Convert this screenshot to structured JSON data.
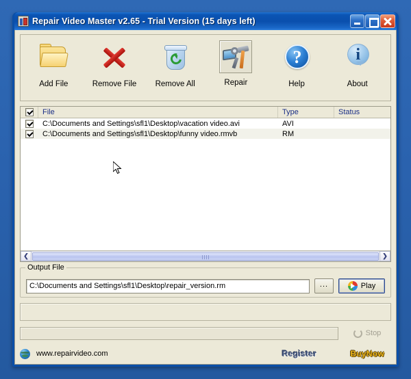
{
  "window": {
    "title": "Repair Video Master v2.65 - Trial Version (15 days left)",
    "app_icon": "app-icon",
    "controls": {
      "minimize": "minimize-button",
      "maximize": "maximize-button",
      "close": "close-button"
    }
  },
  "toolbar": {
    "items": [
      {
        "label": "Add File",
        "icon": "folder-icon"
      },
      {
        "label": "Remove File",
        "icon": "red-x-icon"
      },
      {
        "label": "Remove All",
        "icon": "recycle-bin-icon"
      },
      {
        "label": "Repair",
        "icon": "hammer-wrench-icon"
      },
      {
        "label": "Help",
        "icon": "question-mark-icon"
      },
      {
        "label": "About",
        "icon": "info-icon"
      }
    ]
  },
  "filelist": {
    "columns": [
      "",
      "File",
      "Type",
      "Status"
    ],
    "header_checkbox_checked": true,
    "rows": [
      {
        "checked": true,
        "file": "C:\\Documents and Settings\\sfl1\\Desktop\\vacation video.avi",
        "type": "AVI",
        "status": ""
      },
      {
        "checked": true,
        "file": "C:\\Documents and Settings\\sfl1\\Desktop\\funny video.rmvb",
        "type": "RM",
        "status": ""
      }
    ],
    "scrollbar": {
      "left_arrow": "❮",
      "right_arrow": "❯"
    }
  },
  "output": {
    "legend": "Output File",
    "path": "C:\\Documents and Settings\\sfl1\\Desktop\\repair_version.rm",
    "browse_label": "...",
    "play_label": "Play"
  },
  "progress": {
    "status_text": "",
    "percent": 0,
    "stop_label": "Stop",
    "stop_enabled": false
  },
  "footer": {
    "site": "www.repairvideo.com",
    "register": "Register",
    "buynow": "BuyNow"
  },
  "colors": {
    "titlebar_blue": "#0a4fad",
    "client_bg": "#ece9d8",
    "header_text": "#1b2f86",
    "register": "#45577f",
    "buynow": "#e8b21c",
    "desktop": "#2a62ae"
  }
}
